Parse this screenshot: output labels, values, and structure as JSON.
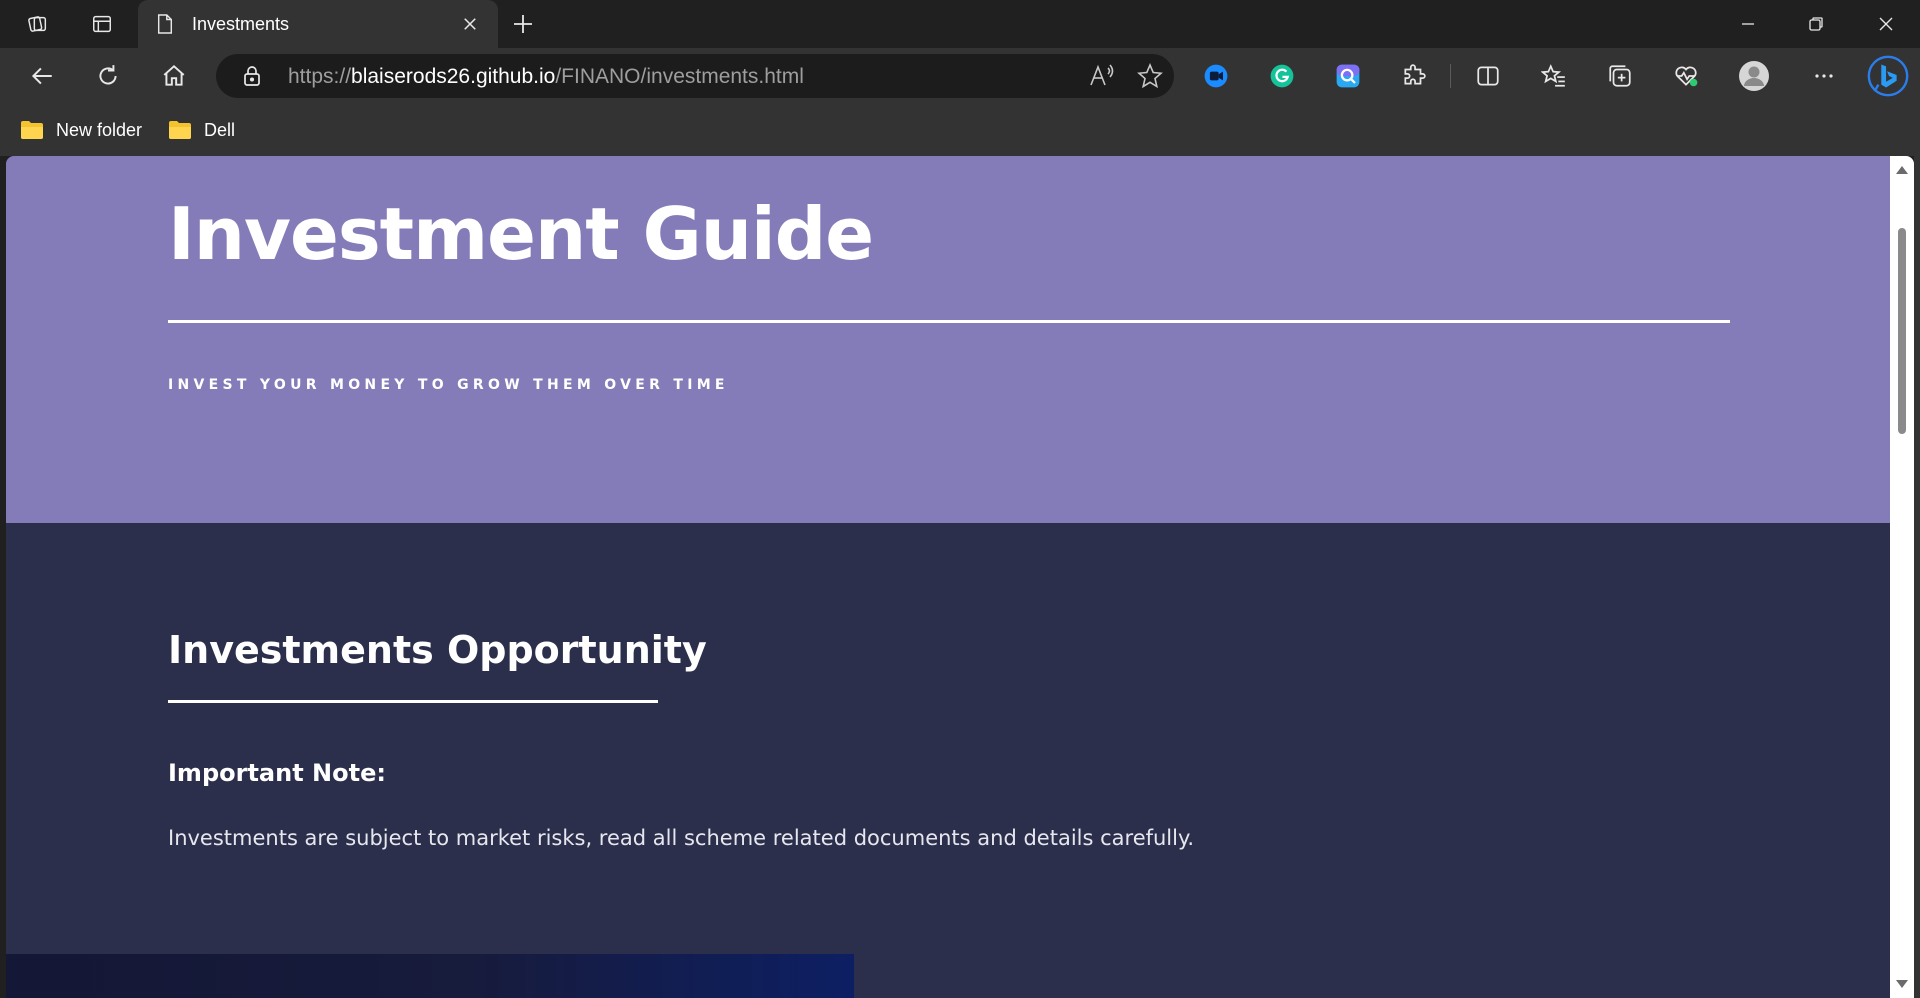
{
  "browser": {
    "tab": {
      "title": "Investments"
    },
    "address": {
      "url_prefix": "https://",
      "url_host": "blaiserods26.github.io",
      "url_path": "/FINANO/investments.html"
    },
    "bookmarks": [
      {
        "label": "New folder"
      },
      {
        "label": "Dell"
      }
    ],
    "colors": {
      "chrome_dark": "#202020",
      "chrome": "#333333",
      "address_field": "#1c1c1c"
    }
  },
  "page": {
    "hero": {
      "title": "Investment Guide",
      "tagline": "INVEST YOUR MONEY TO GROW THEM OVER TIME",
      "background": "#847cb8"
    },
    "section": {
      "heading": "Investments Opportunity",
      "note_heading": "Important Note:",
      "note_text": "Investments are subject to market risks, read all scheme related documents and details carefully.",
      "background": "#2b2f4b"
    }
  }
}
